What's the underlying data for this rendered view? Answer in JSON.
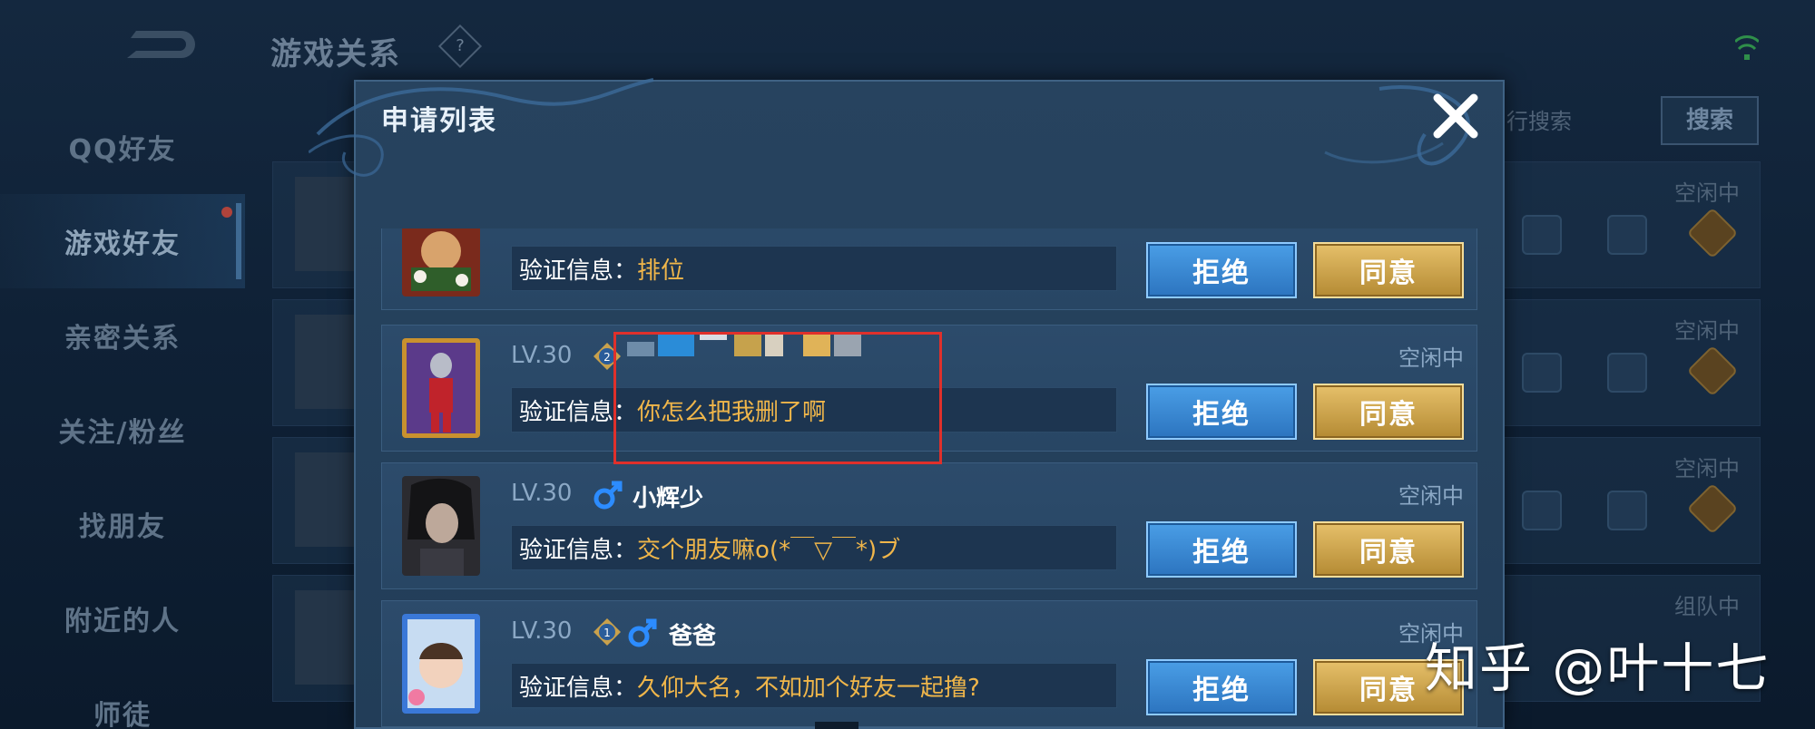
{
  "background": {
    "title": "游戏关系",
    "help_symbol": "?",
    "nav": [
      {
        "label": "QQ好友"
      },
      {
        "label": "游戏好友"
      },
      {
        "label": "亲密关系"
      },
      {
        "label": "关注/粉丝"
      },
      {
        "label": "找朋友"
      },
      {
        "label": "附近的人"
      },
      {
        "label": "师徒"
      }
    ],
    "search_placeholder": "行搜索",
    "search_button": "搜索",
    "rows": [
      {
        "status": "空闲中"
      },
      {
        "status": "空闲中"
      },
      {
        "status": "空闲中"
      },
      {
        "status": "组队中"
      }
    ]
  },
  "modal": {
    "title": "申请列表",
    "close_icon": "close-icon",
    "requests": [
      {
        "level": "",
        "name": "",
        "status": "",
        "verify_label": "验证信息：",
        "verify_text": "排位",
        "reject_label": "拒绝",
        "accept_label": "同意"
      },
      {
        "level": "LV.30",
        "rank": "2",
        "name": "",
        "status": "空闲中",
        "verify_label": "验证信息：",
        "verify_text": "你怎么把我删了啊",
        "reject_label": "拒绝",
        "accept_label": "同意"
      },
      {
        "level": "LV.30",
        "name": "小辉少",
        "status": "空闲中",
        "verify_label": "验证信息：",
        "verify_text": "交个朋友嘛o(*￣▽￣*)ブ",
        "reject_label": "拒绝",
        "accept_label": "同意"
      },
      {
        "level": "LV.30",
        "rank": "1",
        "name": "爸爸",
        "status": "空闲中",
        "verify_label": "验证信息：",
        "verify_text": "久仰大名，不如加个好友一起撸?",
        "reject_label": "拒绝",
        "accept_label": "同意"
      }
    ]
  },
  "watermark": "知乎 @叶十七",
  "colors": {
    "reject_button": "#3a8ad6",
    "accept_button": "#c9a14c",
    "verify_text": "#f0b64a",
    "highlight_box": "#e0302b"
  }
}
